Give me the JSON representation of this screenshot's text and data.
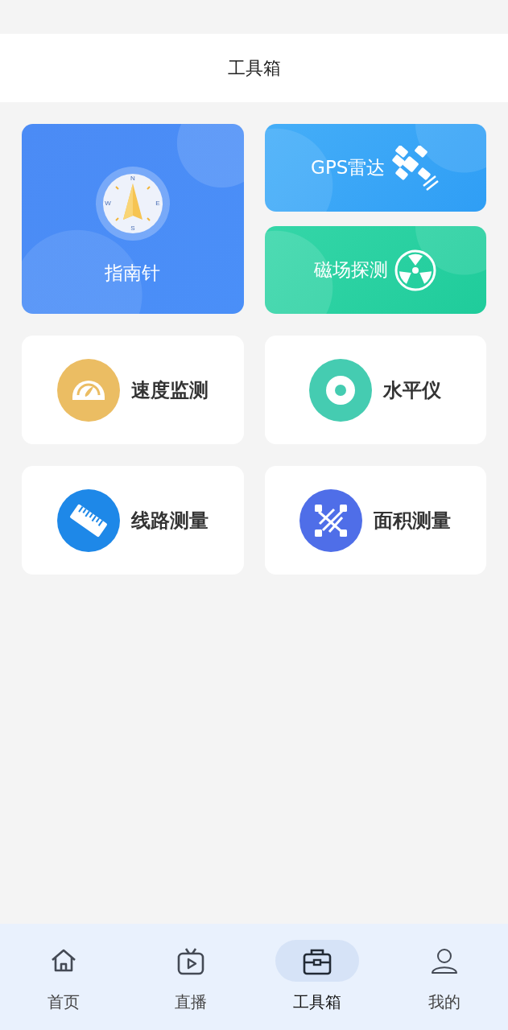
{
  "header": {
    "title": "工具箱"
  },
  "feature_cards": [
    {
      "kind": "compass",
      "label": "指南针",
      "compass_marks": [
        "N",
        "E",
        "S",
        "W"
      ]
    },
    {
      "kind": "gps",
      "label": "GPS雷达"
    },
    {
      "kind": "magnet",
      "label": "磁场探测"
    }
  ],
  "tool_cards": [
    {
      "kind": "speed",
      "label": "速度监测",
      "color": "#ebbd63"
    },
    {
      "kind": "level",
      "label": "水平仪",
      "color": "#45ccb1"
    },
    {
      "kind": "ruler",
      "label": "线路测量",
      "color": "#1e88e8"
    },
    {
      "kind": "area",
      "label": "面积测量",
      "color": "#4f6ee8"
    }
  ],
  "bottom_nav": [
    {
      "kind": "home",
      "label": "首页",
      "selected": false
    },
    {
      "kind": "live",
      "label": "直播",
      "selected": false
    },
    {
      "kind": "toolbox",
      "label": "工具箱",
      "selected": true
    },
    {
      "kind": "profile",
      "label": "我的",
      "selected": false
    }
  ]
}
